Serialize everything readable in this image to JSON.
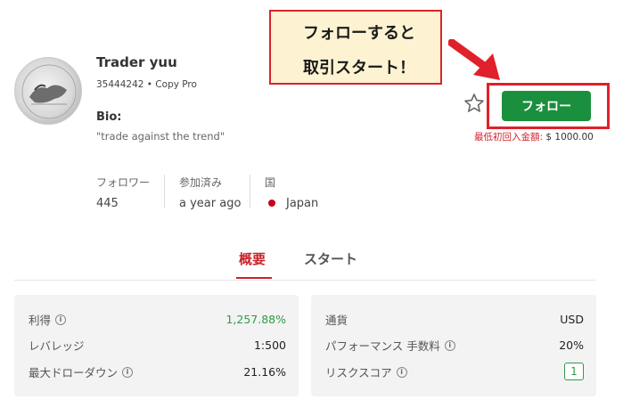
{
  "annotation": {
    "line1": "フォローすると",
    "line2": "取引スタート！"
  },
  "trader": {
    "name": "Trader yuu",
    "id_line": "35444242 • Copy Pro",
    "bio_label": "Bio:",
    "bio_text": "\"trade against the trend\""
  },
  "actions": {
    "follow_label": "フォロー",
    "star_icon": "star-outline-icon",
    "min_deposit_label": "最低初回入金額:",
    "min_deposit_value": "$ 1000.00"
  },
  "stats": [
    {
      "label": "フォロワー",
      "value": "445"
    },
    {
      "label": "参加済み",
      "value": "a year ago"
    },
    {
      "label": "国",
      "value": "Japan"
    }
  ],
  "tabs": [
    {
      "label": "概要",
      "active": true
    },
    {
      "label": "スタート",
      "active": false
    }
  ],
  "left_panel": [
    {
      "label": "利得",
      "value": "1,257.88%",
      "info": true
    },
    {
      "label": "レバレッジ",
      "value": "1:500",
      "info": false
    },
    {
      "label": "最大ドローダウン",
      "value": "21.16%",
      "info": true
    }
  ],
  "right_panel": [
    {
      "label": "通貨",
      "value": "USD",
      "info": false
    },
    {
      "label": "パフォーマンス 手数料",
      "value": "20%",
      "info": true
    },
    {
      "label": "リスクスコア",
      "value": "1",
      "info": true
    }
  ],
  "colors": {
    "follow_green": "#1a8f3e",
    "accent_red": "#c9232b",
    "gain_green": "#2e9b4a",
    "callout_bg": "#fdf3d2"
  }
}
